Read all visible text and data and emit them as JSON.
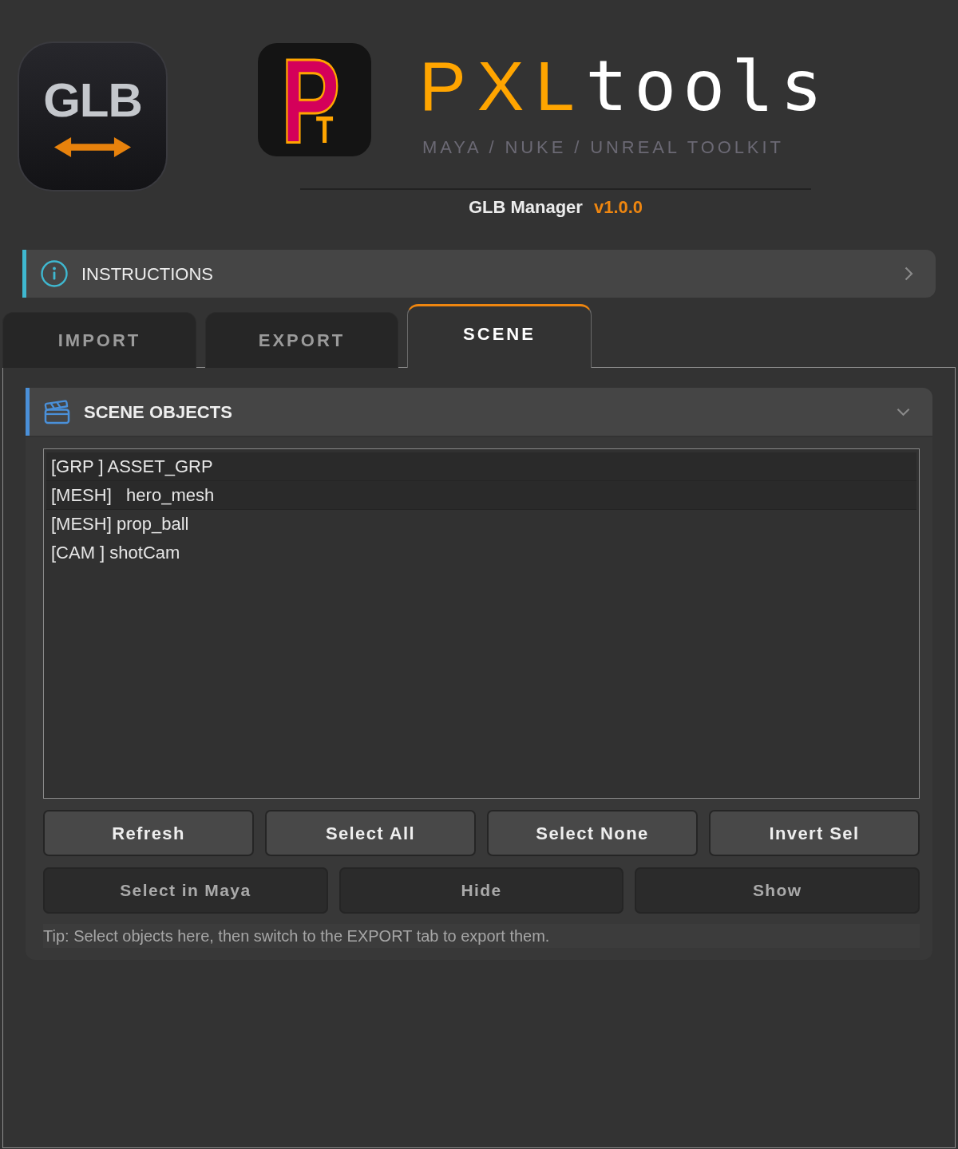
{
  "header": {
    "app_icon": {
      "label": "GLB"
    },
    "logo_mark": {
      "main_letter": "P",
      "sub_letter": "T"
    },
    "brand": {
      "accent": "PXL",
      "rest": "tools"
    },
    "tagline": "MAYA / NUKE / UNREAL TOOLKIT",
    "app_title": "GLB Manager",
    "version": "v1.0.0"
  },
  "instructions": {
    "title": "INSTRUCTIONS",
    "expanded": false
  },
  "tabs": [
    {
      "label": "IMPORT",
      "selected": false
    },
    {
      "label": "EXPORT",
      "selected": false
    },
    {
      "label": "SCENE",
      "selected": true
    }
  ],
  "scene_objects": {
    "title": "SCENE OBJECTS",
    "expanded": true,
    "items": [
      {
        "text": "[GRP ] ASSET_GRP",
        "selected": true
      },
      {
        "text": "[MESH]   hero_mesh",
        "selected": true
      },
      {
        "text": "[MESH] prop_ball",
        "selected": false
      },
      {
        "text": "[CAM ] shotCam",
        "selected": false
      }
    ],
    "button_rows": [
      {
        "buttons": [
          {
            "label": "Refresh",
            "kind": "primary"
          },
          {
            "label": "Select All",
            "kind": "primary"
          },
          {
            "label": "Select None",
            "kind": "primary"
          },
          {
            "label": "Invert Sel",
            "kind": "primary"
          }
        ]
      },
      {
        "buttons": [
          {
            "label": "Select in Maya",
            "kind": "secondary"
          },
          {
            "label": "Hide",
            "kind": "secondary"
          },
          {
            "label": "Show",
            "kind": "secondary"
          }
        ]
      }
    ],
    "tip": "Tip: Select objects here, then switch to the EXPORT tab to export them."
  }
}
